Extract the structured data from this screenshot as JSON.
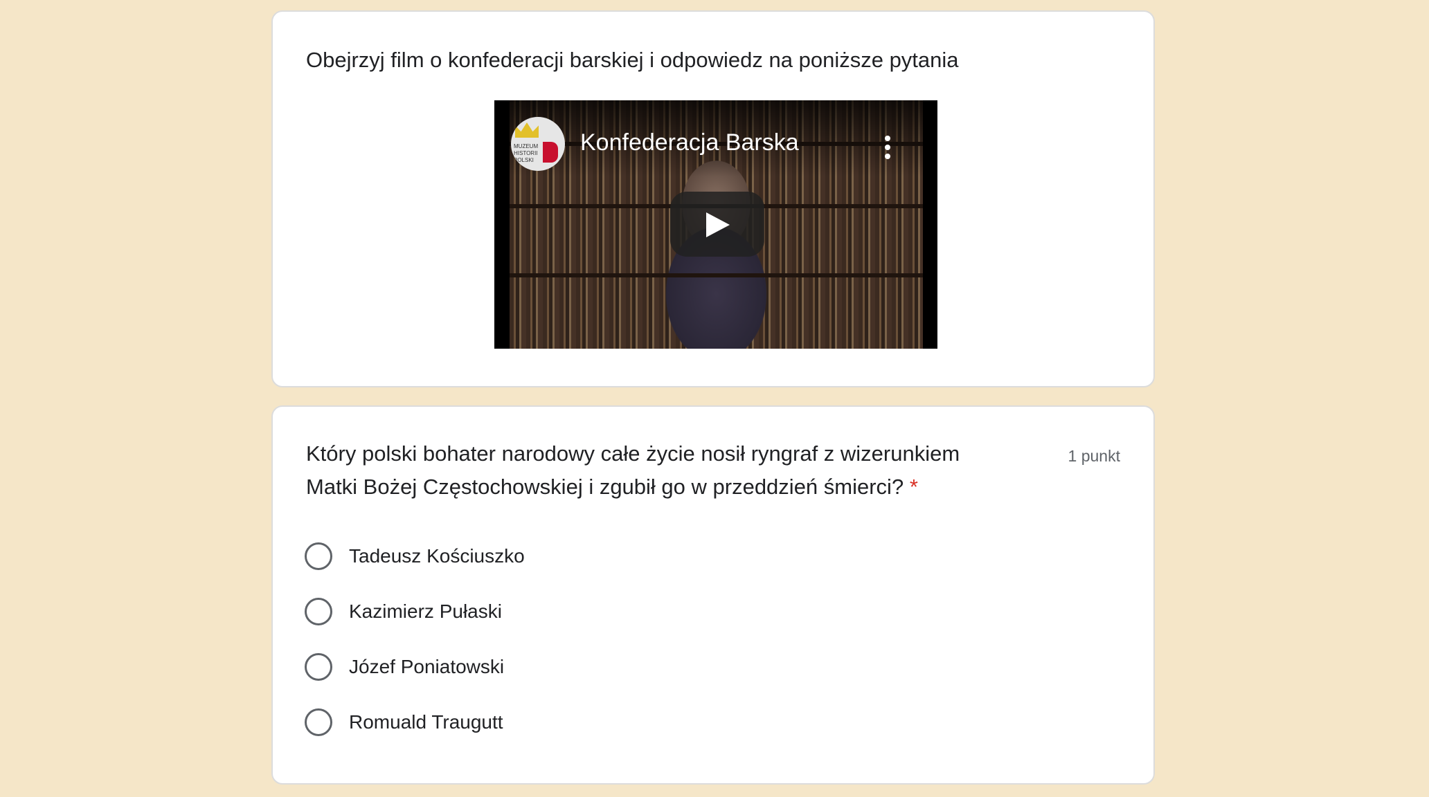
{
  "video_section": {
    "title": "Obejrzyj film o konfederacji barskiej i odpowiedz na poniższe pytania",
    "video": {
      "title": "Konfederacja Barska",
      "channel_logo_text": "MUZEUM HISTORII POLSKI",
      "play_icon": "play-icon",
      "menu_icon": "more-vert-icon"
    }
  },
  "question": {
    "text": "Który polski bohater narodowy całe życie nosił ryngraf z wizerunkiem Matki Bożej Częstochowskiej i zgubił go w przeddzień śmierci?",
    "required_marker": "*",
    "points": "1 punkt",
    "options": [
      {
        "label": "Tadeusz Kościuszko"
      },
      {
        "label": "Kazimierz Pułaski"
      },
      {
        "label": "Józef Poniatowski"
      },
      {
        "label": "Romuald Traugutt"
      }
    ]
  },
  "colors": {
    "background": "#f5e6c8",
    "required": "#d93025"
  }
}
